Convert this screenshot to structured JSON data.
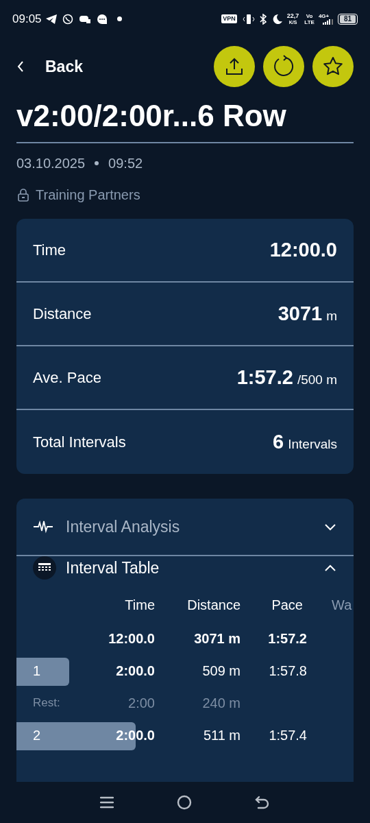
{
  "status_bar": {
    "time": "09:05",
    "vpn": "VPN",
    "speed": "22,7",
    "speed_unit": "K/S",
    "volte_top": "Vo",
    "volte_bottom": "LTE",
    "network": "4G+",
    "battery": "81"
  },
  "header": {
    "back_label": "Back"
  },
  "title": "v2:00/2:00r...6 Row",
  "date": "03.10.2025",
  "time": "09:52",
  "visibility": "Training Partners",
  "summary": [
    {
      "label": "Time",
      "value": "12:00.0"
    },
    {
      "label": "Distance",
      "value": "3071",
      "unit": "m"
    },
    {
      "label": "Ave. Pace",
      "value": "1:57.2",
      "unit": "/500 m"
    },
    {
      "label": "Total Intervals",
      "value": "6",
      "unit": "Intervals"
    }
  ],
  "sections": [
    {
      "kind": "analysis",
      "title": "Interval Analysis",
      "expanded": false
    },
    {
      "kind": "table",
      "title": "Interval Table",
      "expanded": true
    }
  ],
  "table": {
    "columns": [
      "Time",
      "Distance",
      "Pace",
      "Wa"
    ],
    "rows": [
      {
        "kind": "total",
        "time": "12:00.0",
        "distance": "3071 m",
        "pace": "1:57.2"
      },
      {
        "kind": "interval",
        "label": "1",
        "time": "2:00.0",
        "distance": "509 m",
        "pace": "1:57.8"
      },
      {
        "kind": "rest",
        "label": "Rest:",
        "time": "2:00",
        "distance": "240 m"
      },
      {
        "kind": "interval",
        "label": "2",
        "time": "2:00.0",
        "distance": "511 m",
        "pace": "1:57.4"
      }
    ]
  }
}
